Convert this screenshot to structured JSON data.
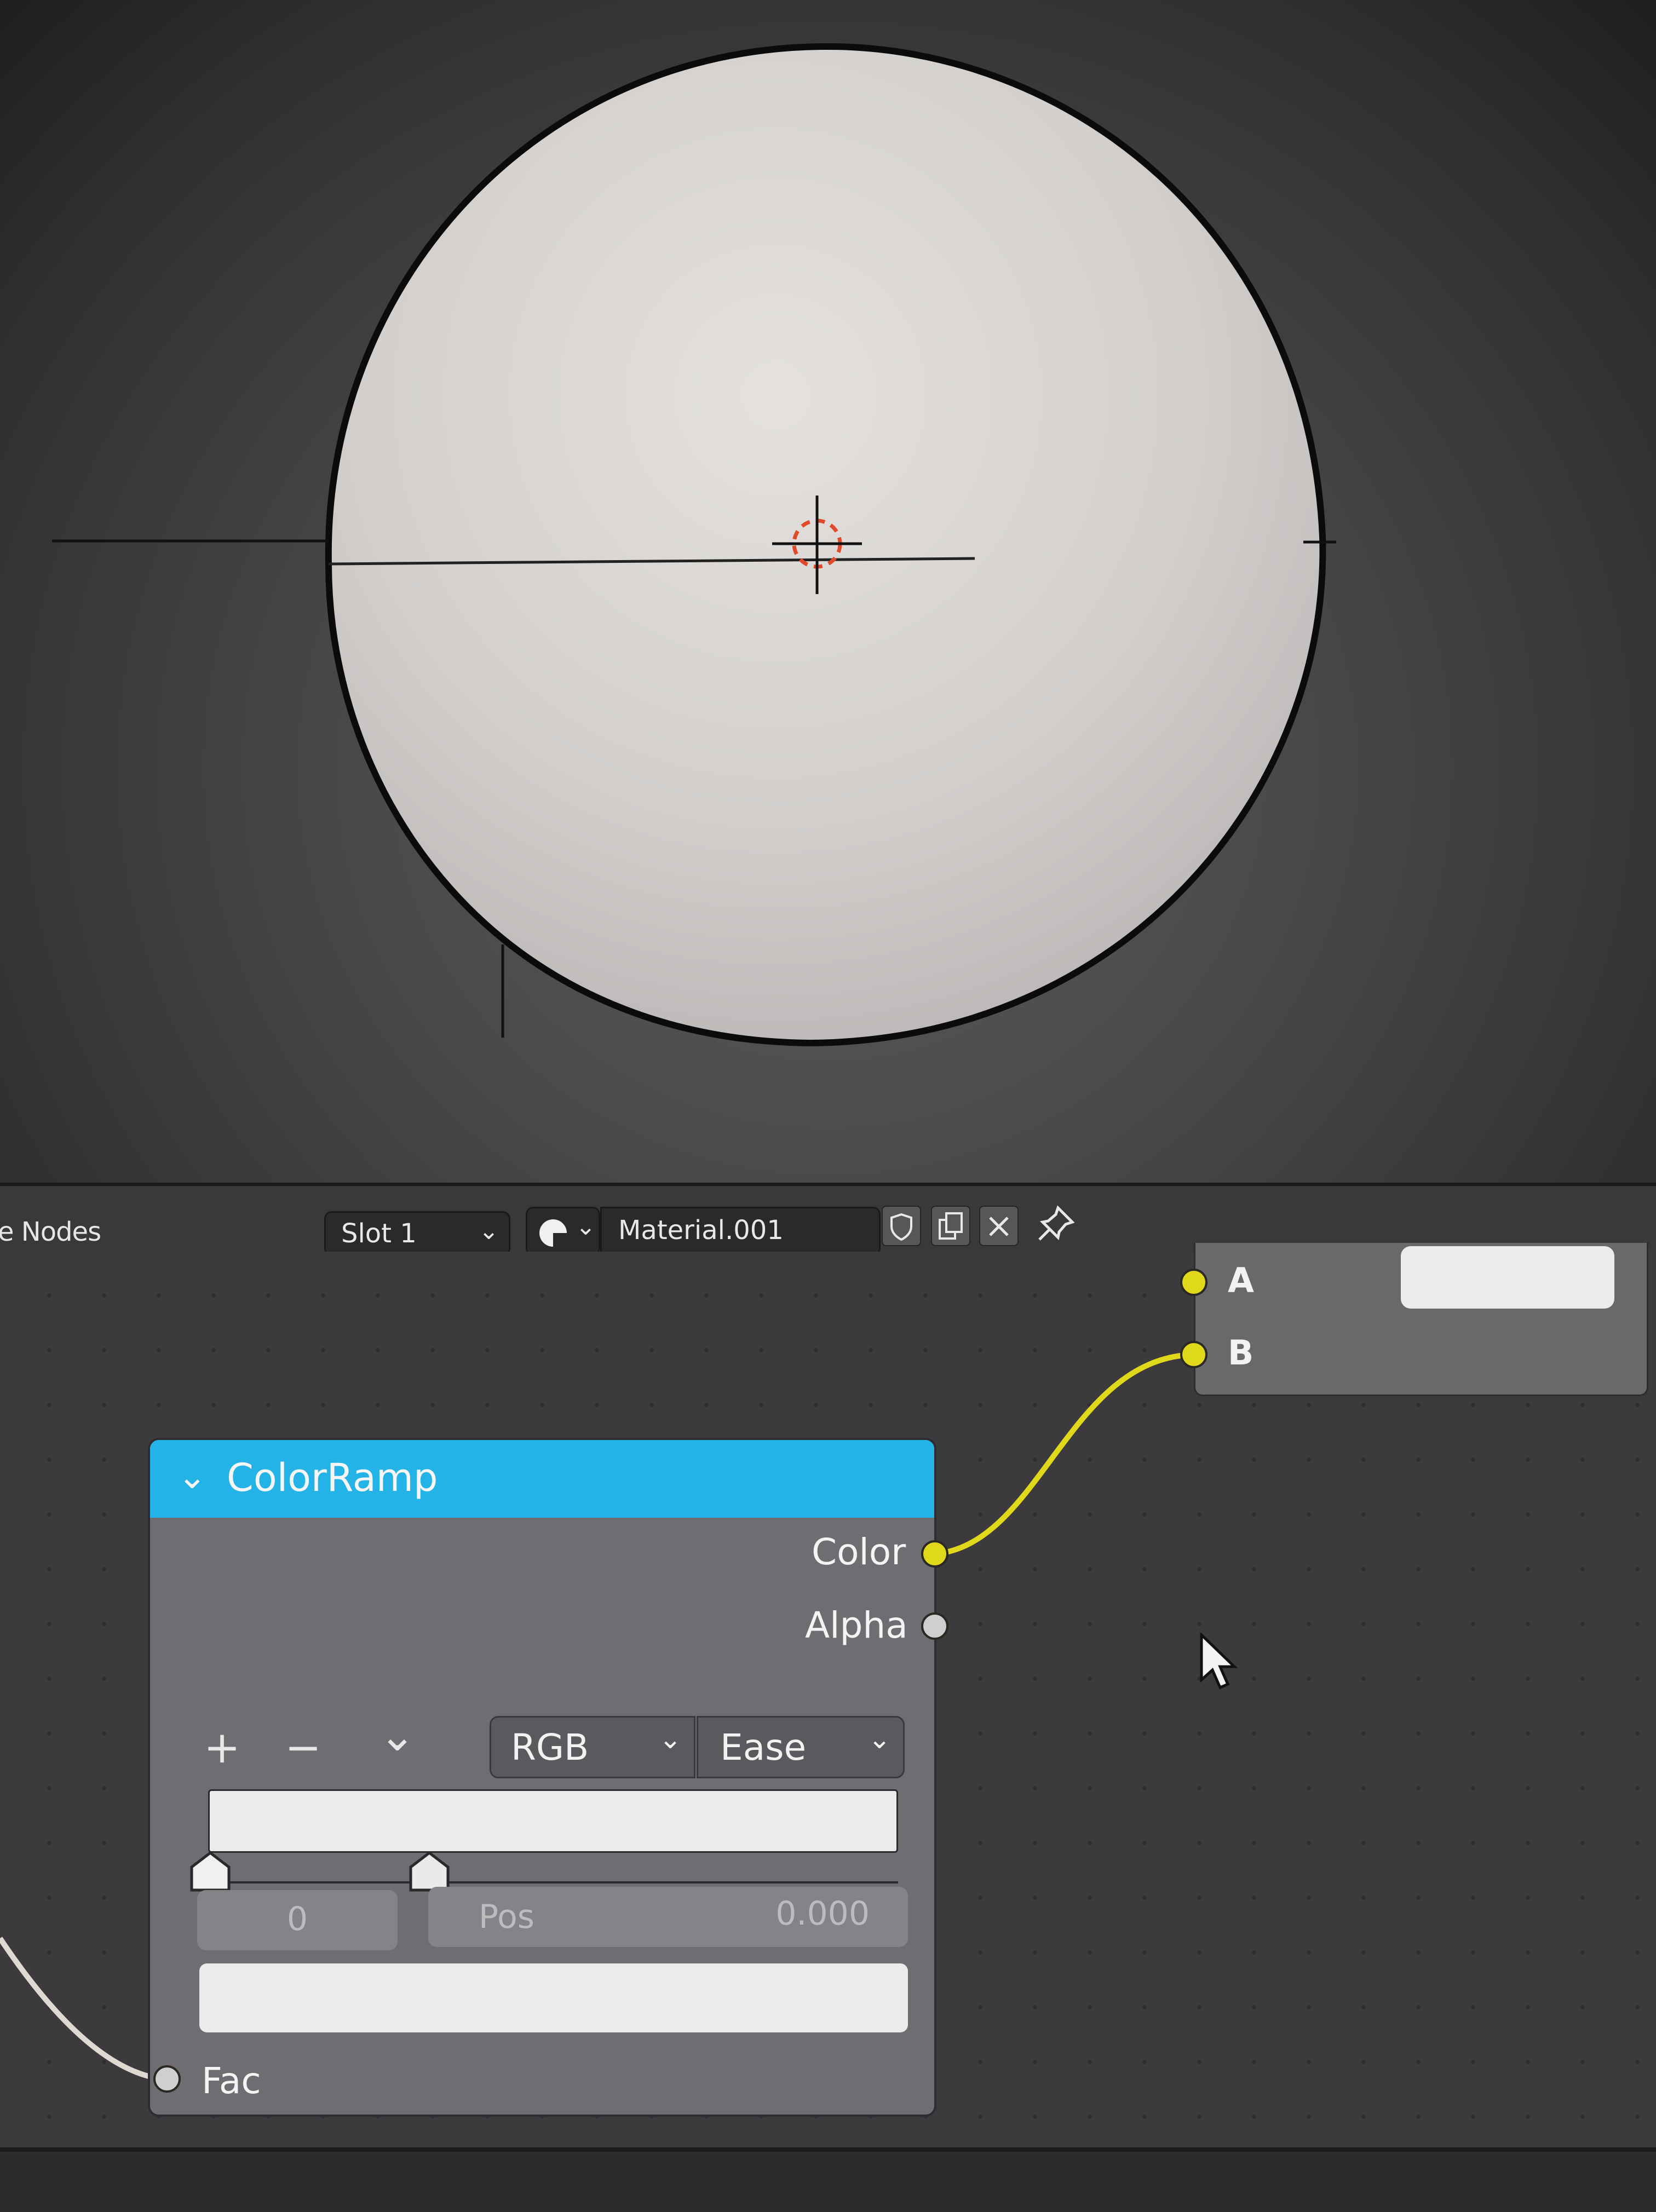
{
  "editor": {
    "label": "e Nodes",
    "slot": "Slot 1",
    "material": "Material.001"
  },
  "mix_node": {
    "input_a": "A",
    "input_b": "B"
  },
  "colorramp": {
    "title": "ColorRamp",
    "outputs": {
      "color": "Color",
      "alpha": "Alpha"
    },
    "tools": {
      "add": "+",
      "remove": "−",
      "menu": "⌄"
    },
    "color_mode": "RGB",
    "interpolation": "Ease",
    "stop_index": "0",
    "pos_label": "Pos",
    "pos_value": "0.000",
    "input_fac": "Fac"
  },
  "colors": {
    "node_header": "#23b3e6",
    "socket_color": "#e0d81a",
    "socket_float": "#cfcfcf"
  }
}
